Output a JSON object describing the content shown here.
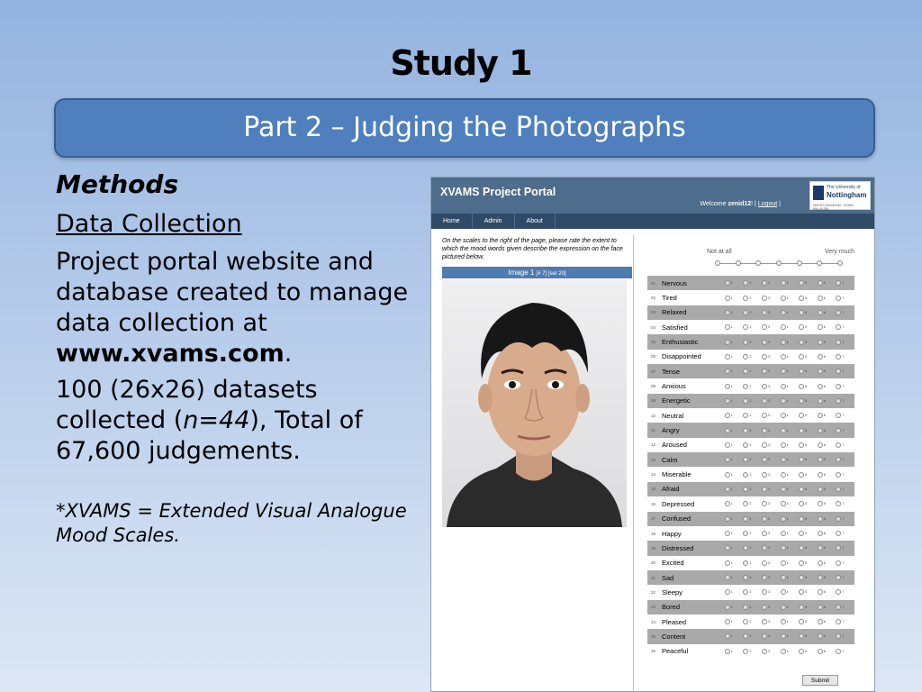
{
  "slide": {
    "title": "Study 1",
    "banner": "Part 2 – Judging the Photographs",
    "methods": "Methods",
    "data_collection": "Data Collection",
    "para1_text": "Project portal website and database created to manage data collection at ",
    "para1_link": "www.xvams.com",
    "para1_end": ".",
    "para2_a": "100 (26x26) datasets collected (",
    "para2_n": "n=44",
    "para2_b": "), Total of 67,600 judgements.",
    "footnote": "*XVAMS = Extended Visual Analogue Mood Scales."
  },
  "portal": {
    "title": "XVAMS Project Portal",
    "welcome": "Welcome ",
    "username": "zenid12",
    "welcome_sep": "! | ",
    "logout": "Logout",
    "welcome_end": " |",
    "logo_line1": "The University of",
    "logo_line2": "Nottingham",
    "logo_line3": "UNITED KINGDOM · CHINA · MALAYSIA",
    "nav": [
      "Home",
      "Admin",
      "About"
    ],
    "instructions": "On the scales to the right of the page, please rate the extent to which the mood words given describe the expression on the face pictured below.",
    "image_label": "Image 1",
    "image_meta": "[# 7] [set 20]",
    "scale_low": "Not at all",
    "scale_high": "Very much",
    "submit": "Submit",
    "option_numbers": [
      "1",
      "2",
      "3",
      "4",
      "5",
      "6",
      "7"
    ],
    "moods": [
      {
        "num": "01",
        "word": "Nervous"
      },
      {
        "num": "02",
        "word": "Tired"
      },
      {
        "num": "03",
        "word": "Relaxed"
      },
      {
        "num": "04",
        "word": "Satisfied"
      },
      {
        "num": "05",
        "word": "Enthusiastic"
      },
      {
        "num": "06",
        "word": "Disappointed"
      },
      {
        "num": "07",
        "word": "Tense"
      },
      {
        "num": "08",
        "word": "Anxious"
      },
      {
        "num": "09",
        "word": "Energetic"
      },
      {
        "num": "10",
        "word": "Neutral"
      },
      {
        "num": "11",
        "word": "Angry"
      },
      {
        "num": "12",
        "word": "Aroused"
      },
      {
        "num": "13",
        "word": "Calm"
      },
      {
        "num": "14",
        "word": "Miserable"
      },
      {
        "num": "15",
        "word": "Afraid"
      },
      {
        "num": "16",
        "word": "Depressed"
      },
      {
        "num": "17",
        "word": "Confused"
      },
      {
        "num": "18",
        "word": "Happy"
      },
      {
        "num": "19",
        "word": "Distressed"
      },
      {
        "num": "20",
        "word": "Excited"
      },
      {
        "num": "21",
        "word": "Sad"
      },
      {
        "num": "22",
        "word": "Sleepy"
      },
      {
        "num": "23",
        "word": "Bored"
      },
      {
        "num": "24",
        "word": "Pleased"
      },
      {
        "num": "25",
        "word": "Content"
      },
      {
        "num": "26",
        "word": "Peaceful"
      }
    ]
  }
}
